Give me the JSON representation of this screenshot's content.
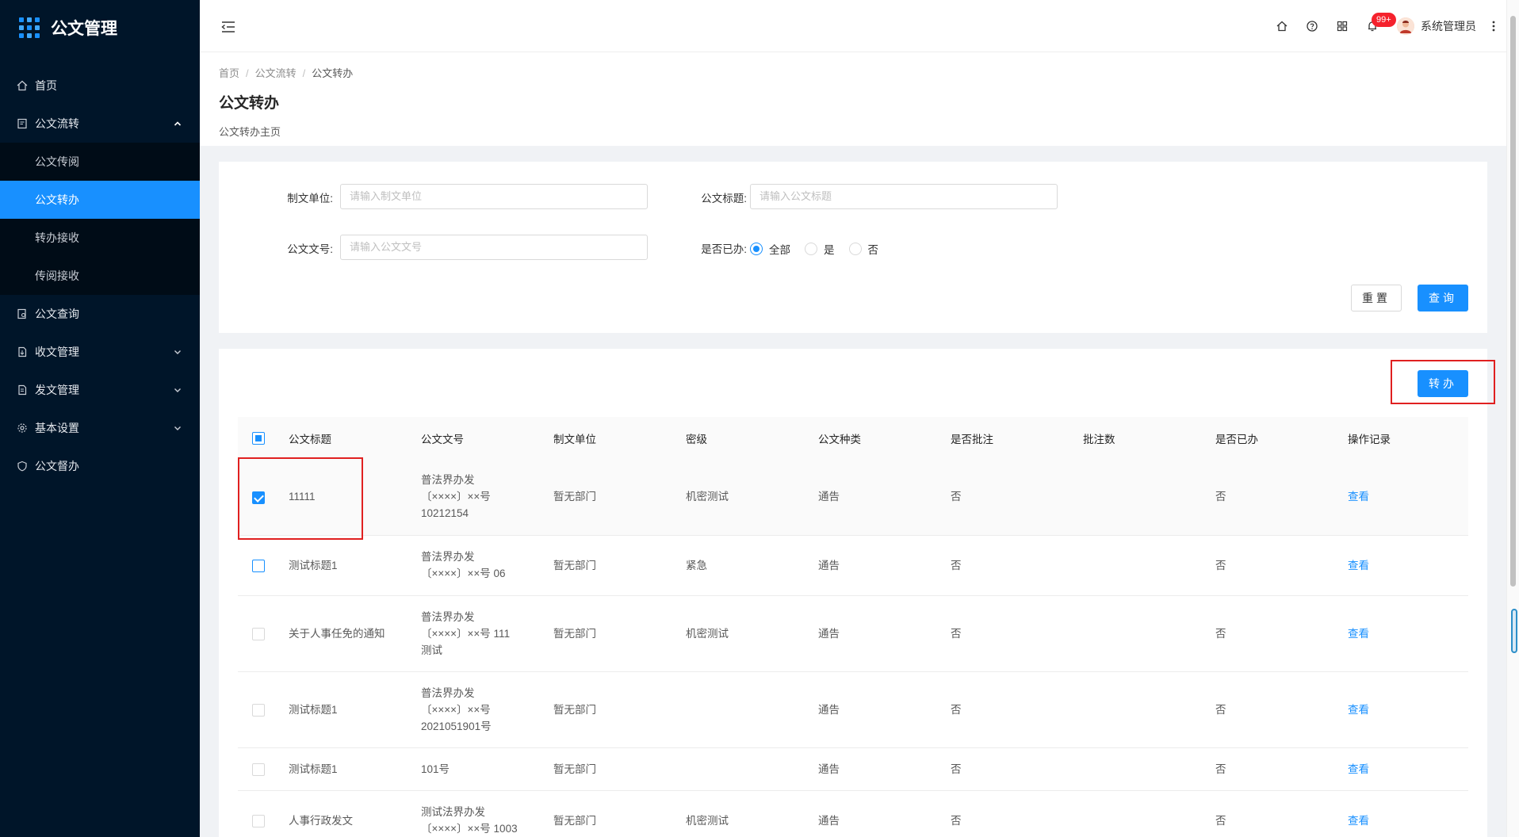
{
  "app": {
    "title": "公文管理"
  },
  "sidebar": {
    "items": [
      {
        "label": "首页",
        "icon": "home-icon"
      },
      {
        "label": "公文流转",
        "icon": "document-icon",
        "expanded": true,
        "children": [
          "公文传阅",
          "公文转办",
          "转办接收",
          "传阅接收"
        ],
        "active_child": "公文转办"
      },
      {
        "label": "公文查询",
        "icon": "search-doc-icon"
      },
      {
        "label": "收文管理",
        "icon": "inbox-doc-icon"
      },
      {
        "label": "发文管理",
        "icon": "send-doc-icon"
      },
      {
        "label": "基本设置",
        "icon": "gear-icon"
      },
      {
        "label": "公文督办",
        "icon": "shield-icon"
      }
    ]
  },
  "header": {
    "badge": "99+",
    "username": "系统管理员"
  },
  "breadcrumb": [
    "首页",
    "公文流转",
    "公文转办"
  ],
  "page": {
    "title": "公文转办",
    "subtitle": "公文转办主页"
  },
  "search": {
    "unit_label": "制文单位:",
    "unit_placeholder": "请输入制文单位",
    "title_label": "公文标题:",
    "title_placeholder": "请输入公文标题",
    "docno_label": "公文文号:",
    "docno_placeholder": "请输入公文文号",
    "done_label": "是否已办:",
    "done_options": [
      "全部",
      "是",
      "否"
    ],
    "done_selected": "全部",
    "reset_label": "重置",
    "query_label": "查询"
  },
  "table": {
    "transfer_label": "转办",
    "columns": [
      "公文标题",
      "公文文号",
      "制文单位",
      "密级",
      "公文种类",
      "是否批注",
      "批注数",
      "是否已办",
      "操作记录"
    ],
    "rows": [
      {
        "title": "11111",
        "docno": "普法界办发\n〔××××〕××号\n10212154",
        "unit": "暂无部门",
        "secret": "机密测试",
        "kind": "通告",
        "annotated": "否",
        "count": "",
        "done": "否",
        "action": "查看",
        "checked": true
      },
      {
        "title": "测试标题1",
        "docno": "普法界办发\n〔××××〕××号 06",
        "unit": "暂无部门",
        "secret": "紧急",
        "kind": "通告",
        "annotated": "否",
        "count": "",
        "done": "否",
        "action": "查看",
        "checked": false
      },
      {
        "title": "关于人事任免的通知",
        "docno": "普法界办发\n〔××××〕××号 111\n测试",
        "unit": "暂无部门",
        "secret": "机密测试",
        "kind": "通告",
        "annotated": "否",
        "count": "",
        "done": "否",
        "action": "查看",
        "checked": false
      },
      {
        "title": "测试标题1",
        "docno": "普法界办发\n〔××××〕××号\n2021051901号",
        "unit": "暂无部门",
        "secret": "",
        "kind": "通告",
        "annotated": "否",
        "count": "",
        "done": "否",
        "action": "查看",
        "checked": false
      },
      {
        "title": "测试标题1",
        "docno": "101号",
        "unit": "暂无部门",
        "secret": "",
        "kind": "通告",
        "annotated": "否",
        "count": "",
        "done": "否",
        "action": "查看",
        "checked": false
      },
      {
        "title": "人事行政发文",
        "docno": "测试法界办发\n〔××××〕××号 1003",
        "unit": "暂无部门",
        "secret": "机密测试",
        "kind": "通告",
        "annotated": "否",
        "count": "",
        "done": "否",
        "action": "查看",
        "checked": false
      }
    ]
  },
  "colors": {
    "primary": "#1890ff",
    "sidebar": "#001529",
    "highlight": "#e02020"
  }
}
